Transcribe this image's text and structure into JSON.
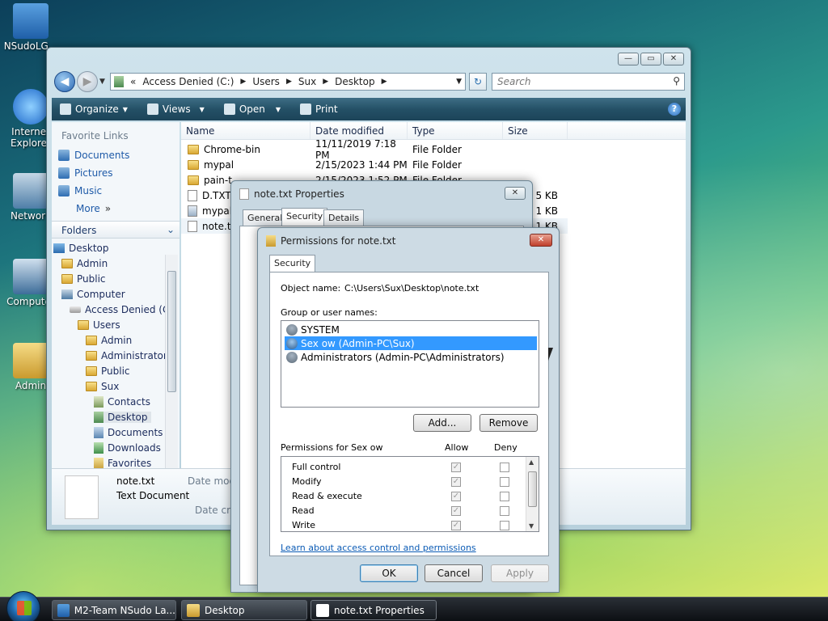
{
  "desktop": {
    "icons": [
      {
        "label": "NSudoLG..."
      },
      {
        "label": "Internet Explorer"
      },
      {
        "label": "Network"
      },
      {
        "label": "Computer"
      },
      {
        "label": "Admin"
      }
    ]
  },
  "explorer": {
    "address": [
      "«",
      "Access Denied (C:)",
      "Users",
      "Sux",
      "Desktop"
    ],
    "search_placeholder": "Search",
    "toolbar": {
      "organize": "Organize",
      "views": "Views",
      "open": "Open",
      "print": "Print"
    },
    "favorite_links_header": "Favorite Links",
    "favorite_links": [
      "Documents",
      "Pictures",
      "Music"
    ],
    "more": "More",
    "folders_header": "Folders",
    "tree": [
      "Desktop",
      "Admin",
      "Public",
      "Computer",
      "Access Denied (C:)",
      "Users",
      "Admin",
      "Administrator",
      "Public",
      "Sux",
      "Contacts",
      "Desktop",
      "Documents",
      "Downloads",
      "Favorites"
    ],
    "columns": [
      "Name",
      "Date modified",
      "Type",
      "Size"
    ],
    "files": [
      {
        "name": "Chrome-bin",
        "date": "11/11/2019 7:18 PM",
        "type": "File Folder",
        "size": ""
      },
      {
        "name": "mypal",
        "date": "2/15/2023 1:44 PM",
        "type": "File Folder",
        "size": ""
      },
      {
        "name": "pain-t...",
        "date": "2/15/2023 1:52 PM",
        "type": "File Folder",
        "size": ""
      },
      {
        "name": "D.TXT",
        "date": "",
        "type": "",
        "size": "5 KB"
      },
      {
        "name": "mypal",
        "date": "",
        "type": "",
        "size": "1 KB"
      },
      {
        "name": "note.txt",
        "date": "",
        "type": "",
        "size": "1 KB"
      }
    ],
    "details": {
      "name": "note.txt",
      "type": "Text Document",
      "date_modified_label": "Date mod",
      "date_created_label": "Date cre"
    }
  },
  "properties": {
    "title": "note.txt Properties",
    "tabs": [
      "General",
      "Security",
      "Details"
    ]
  },
  "permissions": {
    "title": "Permissions for note.txt",
    "tab": "Security",
    "object_name_label": "Object name:",
    "object_name_value": "C:\\Users\\Sux\\Desktop\\note.txt",
    "group_label": "Group or user names:",
    "users": [
      {
        "name": "SYSTEM",
        "selected": false
      },
      {
        "name": "Sex ow (Admin-PC\\Sux)",
        "selected": true
      },
      {
        "name": "Administrators (Admin-PC\\Administrators)",
        "selected": false
      }
    ],
    "add_button": "Add...",
    "remove_button": "Remove",
    "perm_header": "Permissions for Sex ow",
    "allow_header": "Allow",
    "deny_header": "Deny",
    "permissions": [
      {
        "name": "Full control",
        "allow": true,
        "deny": false
      },
      {
        "name": "Modify",
        "allow": true,
        "deny": false
      },
      {
        "name": "Read & execute",
        "allow": true,
        "deny": false
      },
      {
        "name": "Read",
        "allow": true,
        "deny": false
      },
      {
        "name": "Write",
        "allow": true,
        "deny": false
      }
    ],
    "learn_link": "Learn about access control and permissions",
    "ok": "OK",
    "cancel": "Cancel",
    "apply": "Apply"
  },
  "taskbar": {
    "tasks": [
      "M2-Team NSudo La...",
      "Desktop",
      "note.txt Properties"
    ]
  }
}
